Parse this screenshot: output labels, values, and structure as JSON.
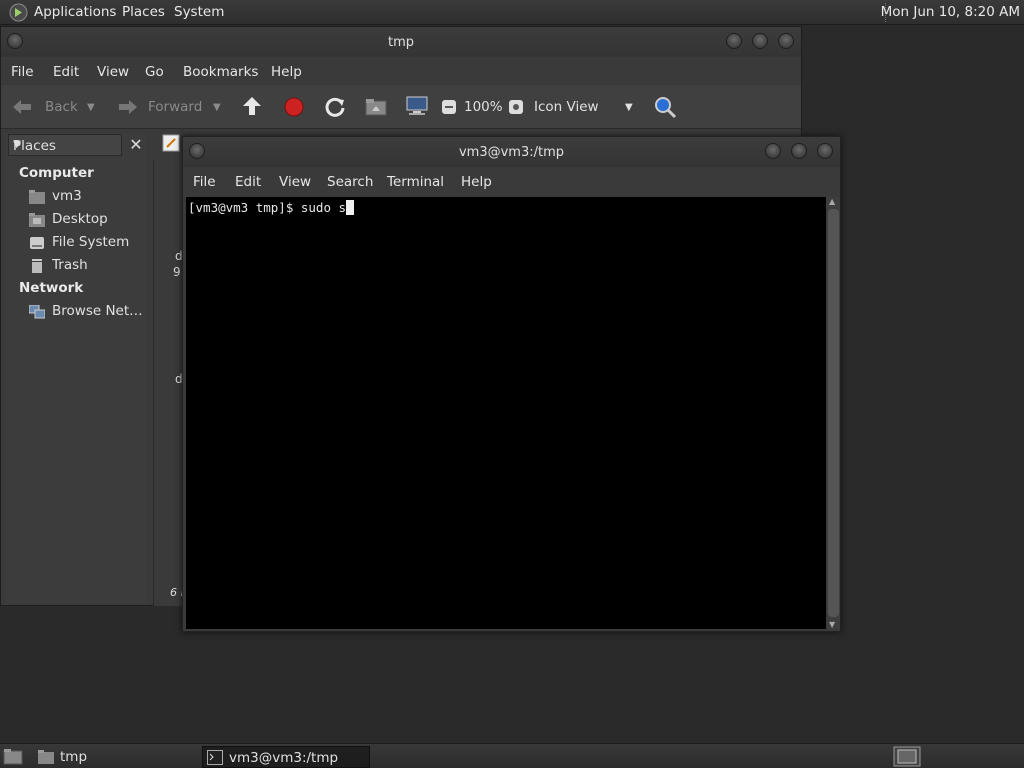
{
  "top_panel": {
    "menus": [
      "Applications",
      "Places",
      "System"
    ],
    "clock": "Mon Jun 10,  8:20 AM"
  },
  "file_manager": {
    "title": "tmp",
    "menus": [
      "File",
      "Edit",
      "View",
      "Go",
      "Bookmarks",
      "Help"
    ],
    "toolbar": {
      "back_label": "Back",
      "forward_label": "Forward",
      "zoom": "100%",
      "view_mode": "Icon View"
    },
    "sidebar": {
      "selector_label": "Places",
      "section_computer": "Computer",
      "computer_items": [
        "vm3",
        "Desktop",
        "File System",
        "Trash"
      ],
      "section_network": "Network",
      "network_items": [
        "Browse Net…"
      ]
    },
    "content_fragments": [
      "d",
      "9.",
      "d",
      "6 i"
    ]
  },
  "terminal": {
    "title": "vm3@vm3:/tmp",
    "menus": [
      "File",
      "Edit",
      "View",
      "Search",
      "Terminal",
      "Help"
    ],
    "line": "[vm3@vm3 tmp]$ sudo s"
  },
  "taskbar": {
    "tasks": [
      "tmp",
      "vm3@vm3:/tmp"
    ]
  },
  "colors": {
    "panel": "#333333",
    "window": "#3a3a3a",
    "terminal_bg": "#000000",
    "record_red": "#cc2222",
    "zoom_blue": "#2a6fd6"
  }
}
